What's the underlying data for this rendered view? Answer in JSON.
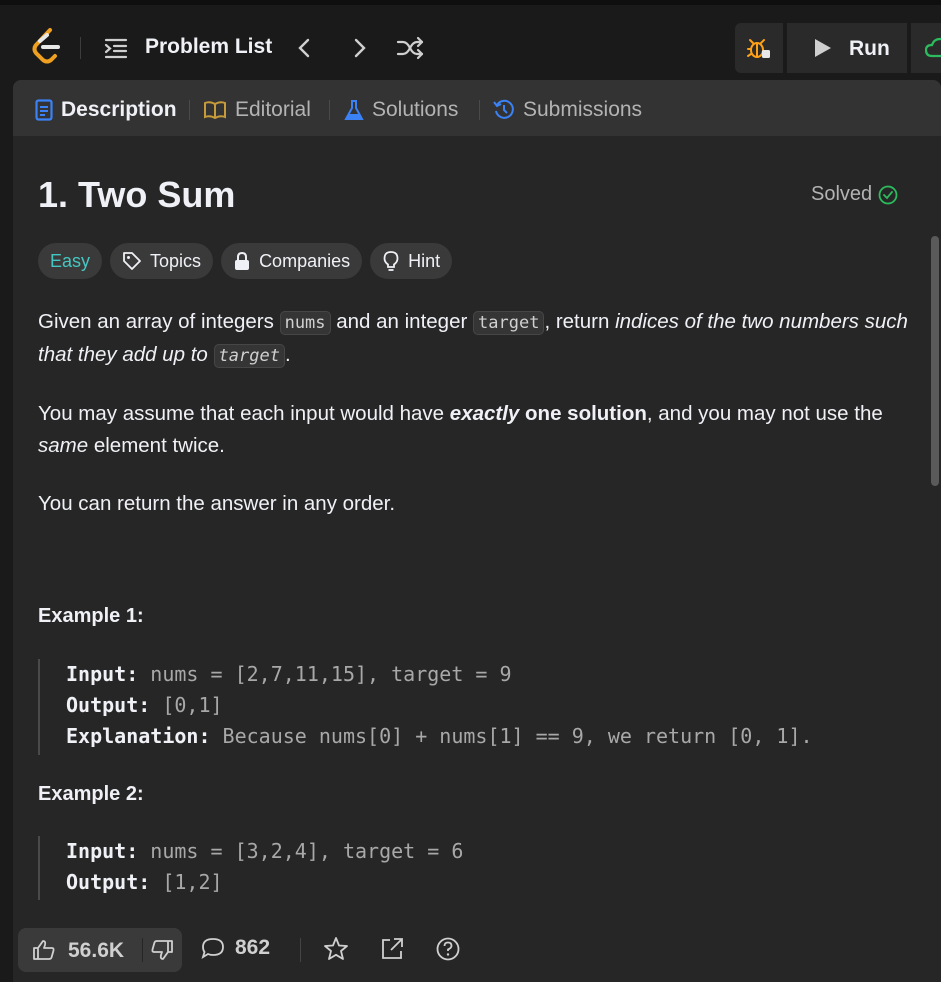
{
  "topbar": {
    "problem_list_label": "Problem List",
    "run_label": "Run"
  },
  "tabs": [
    {
      "label": "Description",
      "icon": "description-icon",
      "color": "#3b82f6"
    },
    {
      "label": "Editorial",
      "icon": "book-icon",
      "color": "#c79a3a"
    },
    {
      "label": "Solutions",
      "icon": "flask-icon",
      "color": "#3b82f6"
    },
    {
      "label": "Submissions",
      "icon": "history-icon",
      "color": "#3b82f6"
    }
  ],
  "problem": {
    "title": "1. Two Sum",
    "status": "Solved",
    "difficulty": "Easy",
    "chips": [
      "Topics",
      "Companies",
      "Hint"
    ],
    "desc": {
      "p1_a": "Given an array of integers ",
      "p1_code1": "nums",
      "p1_b": " and an integer ",
      "p1_code2": "target",
      "p1_c": ", return ",
      "p1_em": "indices of the two numbers such that they add up to",
      "p1_code3": "target",
      "p1_d": ".",
      "p2_a": "You may assume that each input would have ",
      "p2_strong_em": "exactly",
      "p2_strong": " one solution",
      "p2_b": ", and you may not use the ",
      "p2_em": "same",
      "p2_c": " element twice.",
      "p3": "You can return the answer in any order."
    },
    "examples": [
      {
        "heading": "Example 1:",
        "input_label": "Input:",
        "input": " nums = [2,7,11,15], target = 9",
        "output_label": "Output:",
        "output": " [0,1]",
        "explanation_label": "Explanation:",
        "explanation": " Because nums[0] + nums[1] == 9, we return [0, 1]."
      },
      {
        "heading": "Example 2:",
        "input_label": "Input:",
        "input": " nums = [3,2,4], target = 6",
        "output_label": "Output:",
        "output": " [1,2]"
      }
    ]
  },
  "footer": {
    "likes": "56.6K",
    "comments": "862"
  },
  "colors": {
    "easy": "#46c6c2",
    "solved": "#2cbb5d",
    "submit": "#2cbb5d",
    "debug": "#ffa116"
  }
}
